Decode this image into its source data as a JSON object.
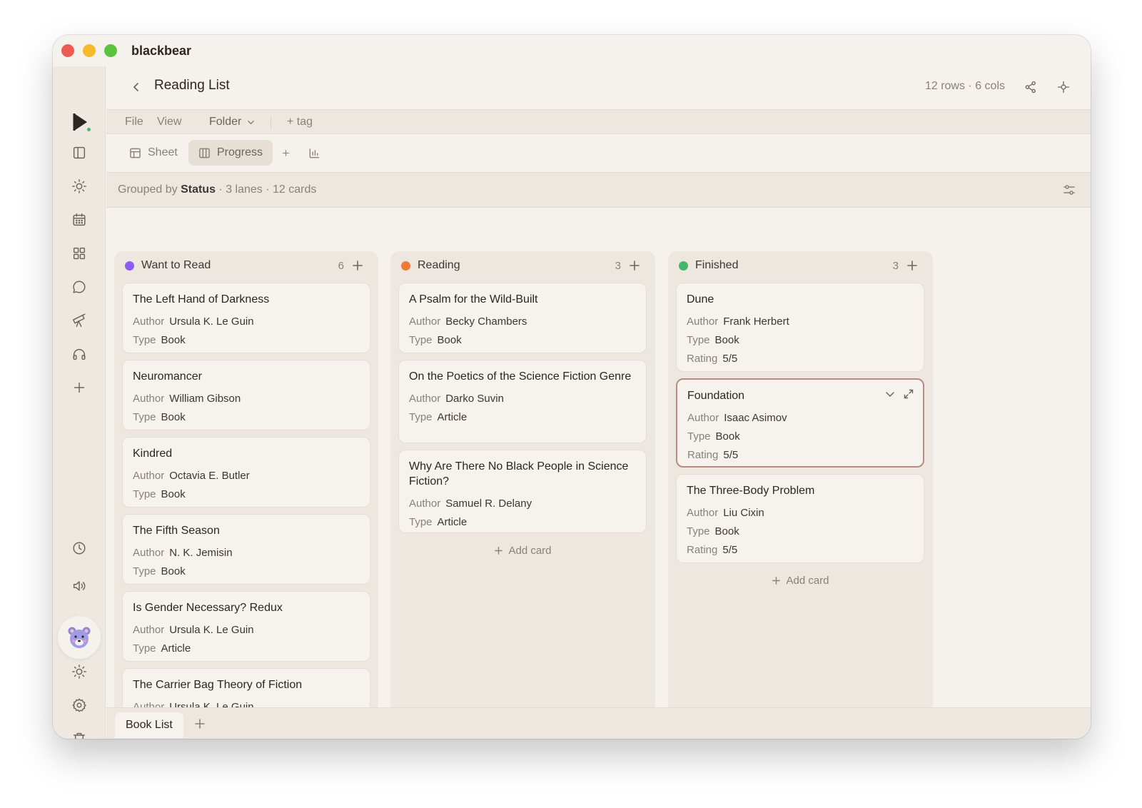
{
  "app": {
    "name": "blackbear"
  },
  "header": {
    "title": "Reading List",
    "meta": "12 rows · 6 cols"
  },
  "menu": {
    "file": "File",
    "view": "View",
    "folder": "Folder",
    "tag": "+ tag"
  },
  "views": [
    {
      "label": "Sheet"
    },
    {
      "label": "Progress"
    }
  ],
  "grouping": {
    "prefix": "Grouped by",
    "field": "Status",
    "summary": "· 3 lanes · 12 cards"
  },
  "colors": {
    "want": "#8b5cf6",
    "reading": "#ef7a35",
    "finished": "#44b868",
    "selected_border": "#b58c86"
  },
  "labels": {
    "author": "Author",
    "type": "Type",
    "rating": "Rating",
    "add_card": "Add card"
  },
  "lanes": [
    {
      "name": "Want to Read",
      "count": "6",
      "cards": [
        {
          "title": "The Left Hand of Darkness",
          "author": "Ursula K. Le Guin",
          "type": "Book"
        },
        {
          "title": "Neuromancer",
          "author": "William Gibson",
          "type": "Book"
        },
        {
          "title": "Kindred",
          "author": "Octavia E. Butler",
          "type": "Book"
        },
        {
          "title": "The Fifth Season",
          "author": "N. K. Jemisin",
          "type": "Book"
        },
        {
          "title": "Is Gender Necessary? Redux",
          "author": "Ursula K. Le Guin",
          "type": "Article"
        },
        {
          "title": "The Carrier Bag Theory of Fiction",
          "author": "Ursula K. Le Guin",
          "type": ""
        }
      ]
    },
    {
      "name": "Reading",
      "count": "3",
      "cards": [
        {
          "title": "A Psalm for the Wild-Built",
          "author": "Becky Chambers",
          "type": "Book"
        },
        {
          "title": "On the Poetics of the Science Fiction Genre",
          "author": "Darko Suvin",
          "type": "Article"
        },
        {
          "title": "Why Are There No Black People in Science Fiction?",
          "author": "Samuel R. Delany",
          "type": "Article"
        }
      ]
    },
    {
      "name": "Finished",
      "count": "3",
      "cards": [
        {
          "title": "Dune",
          "author": "Frank Herbert",
          "type": "Book",
          "rating": "5/5"
        },
        {
          "title": "Foundation",
          "author": "Isaac Asimov",
          "type": "Book",
          "rating": "5/5"
        },
        {
          "title": "The Three-Body Problem",
          "author": "Liu Cixin",
          "type": "Book",
          "rating": "5/5"
        }
      ]
    }
  ],
  "sheets": [
    {
      "label": "Book List"
    }
  ]
}
